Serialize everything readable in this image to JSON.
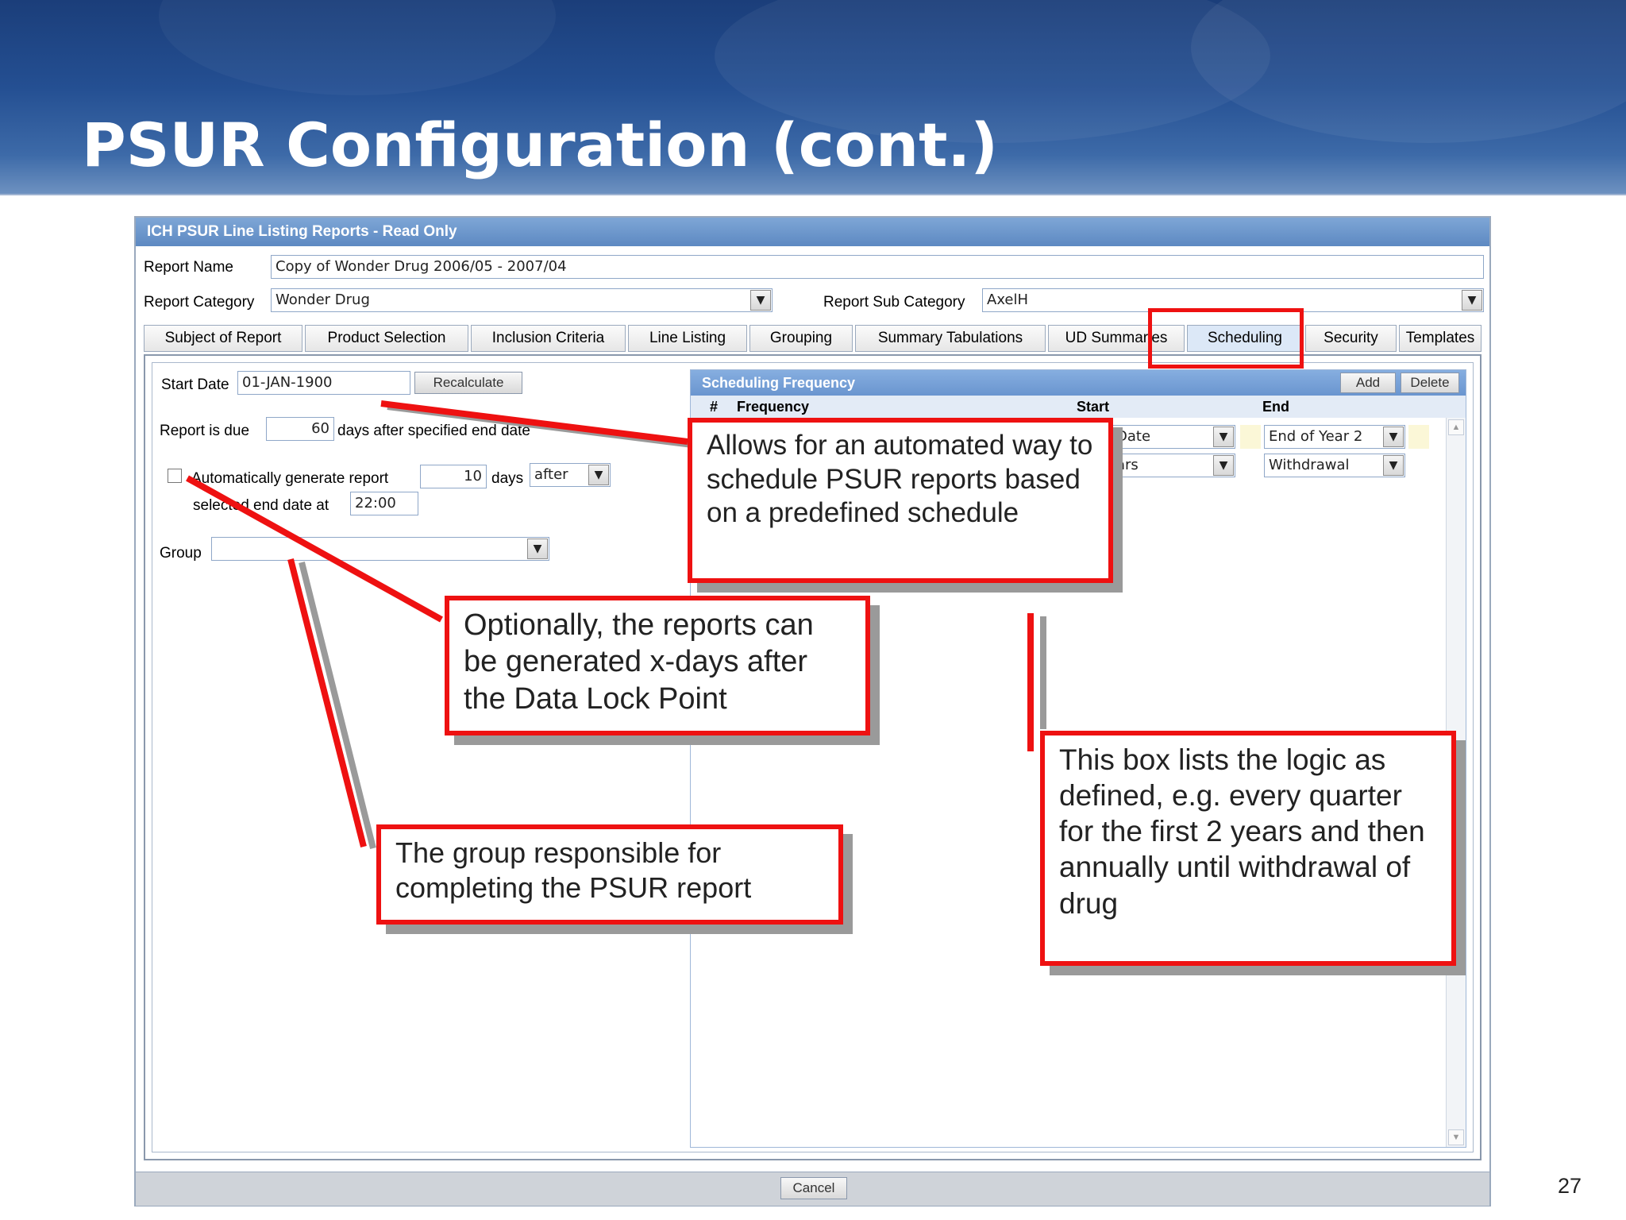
{
  "slide": {
    "title": "PSUR Configuration (cont.)",
    "page_number": "27"
  },
  "app": {
    "window_title": "ICH PSUR Line Listing Reports - Read Only",
    "report_name_label": "Report Name",
    "report_name_value": "Copy of Wonder Drug 2006/05 - 2007/04",
    "report_category_label": "Report Category",
    "report_category_value": "Wonder Drug",
    "report_sub_category_label": "Report Sub Category",
    "report_sub_category_value": "AxelH",
    "tabs": [
      "Subject of Report",
      "Product Selection",
      "Inclusion Criteria",
      "Line Listing",
      "Grouping",
      "Summary Tabulations",
      "UD Summaries",
      "Scheduling",
      "Security",
      "Templates"
    ],
    "active_tab": "Scheduling",
    "start_date_label": "Start Date",
    "start_date_value": "01-JAN-1900",
    "recalculate_label": "Recalculate",
    "report_due_label": "Report is due",
    "report_due_value": "60",
    "report_due_suffix": "days after specified end date",
    "auto_generate_checked": false,
    "auto_generate_label": "Automatically generate report",
    "auto_days_value": "10",
    "auto_days_label": "days",
    "auto_when_value": "after",
    "selected_end_label": "selected end date at",
    "selected_end_time": "22:00",
    "group_label": "Group",
    "group_value": "",
    "scheduling": {
      "title": "Scheduling Frequency",
      "add_label": "Add",
      "delete_label": "Delete",
      "col_hash": "#",
      "col_frequency": "Frequency",
      "col_start": "Start",
      "col_end": "End",
      "rows": [
        {
          "start_fragment": "Date",
          "end": "End of Year 2"
        },
        {
          "start_fragment": "ars",
          "end": "Withdrawal"
        }
      ]
    },
    "cancel_label": "Cancel"
  },
  "callouts": {
    "schedule": "Allows for an automated way to schedule PSUR reports based on a predefined schedule",
    "optional": "Optionally, the reports can be generated x-days after the Data Lock Point",
    "group": "The group responsible for completing the PSUR report",
    "logic": "This box lists the logic as defined, e.g. every quarter for the first 2 years and then annually until withdrawal of drug"
  },
  "colors": {
    "callout_border": "#ee1111",
    "banner": "#244f92",
    "app_header": "#6a95cf"
  }
}
